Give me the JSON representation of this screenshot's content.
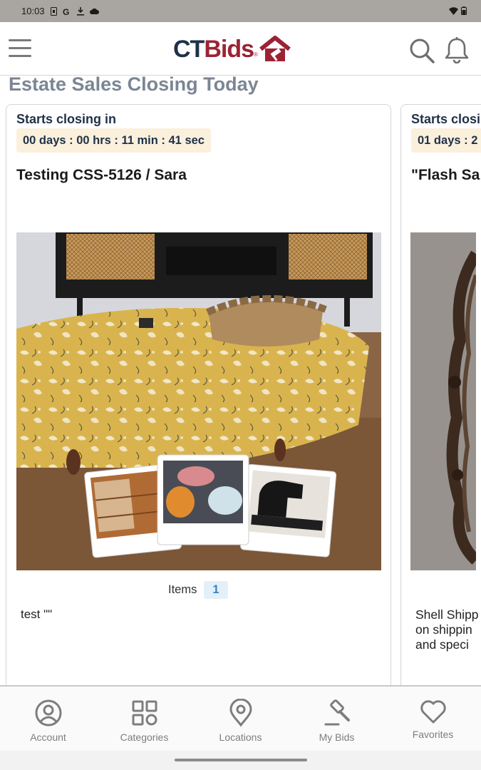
{
  "status_bar": {
    "time": "10:03",
    "icons": [
      "sim-icon",
      "google-icon",
      "download-icon",
      "cloud-icon",
      "wifi-icon",
      "battery-icon"
    ]
  },
  "header": {
    "logo_ct": "CT",
    "logo_bids": "Bids",
    "logo_reg": "®"
  },
  "section": {
    "title": "Estate Sales Closing Today"
  },
  "cards": [
    {
      "closing_label": "Starts closing in",
      "countdown": "00 days : 00 hrs : 11 min : 41 sec",
      "title": "Testing CSS-5126 / Sara",
      "items_label": "Items",
      "items_count": "1",
      "description": "test \"\""
    },
    {
      "closing_label": "Starts closing in",
      "countdown": "01 days : 2",
      "title": "\"Flash Sa",
      "description_lines": [
        "Shell Shipp",
        "on shippin",
        "and speci"
      ]
    }
  ],
  "bottom_nav": [
    {
      "label": "Account",
      "icon": "account-icon"
    },
    {
      "label": "Categories",
      "icon": "categories-icon"
    },
    {
      "label": "Locations",
      "icon": "location-pin-icon"
    },
    {
      "label": "My Bids",
      "icon": "gavel-icon"
    },
    {
      "label": "Favorites",
      "icon": "heart-icon"
    }
  ],
  "colors": {
    "brand_navy": "#1f3148",
    "brand_red": "#9b2335",
    "countdown_bg": "#fbf0dc",
    "section_title": "#7b8694",
    "items_badge": "#3b82c4"
  }
}
